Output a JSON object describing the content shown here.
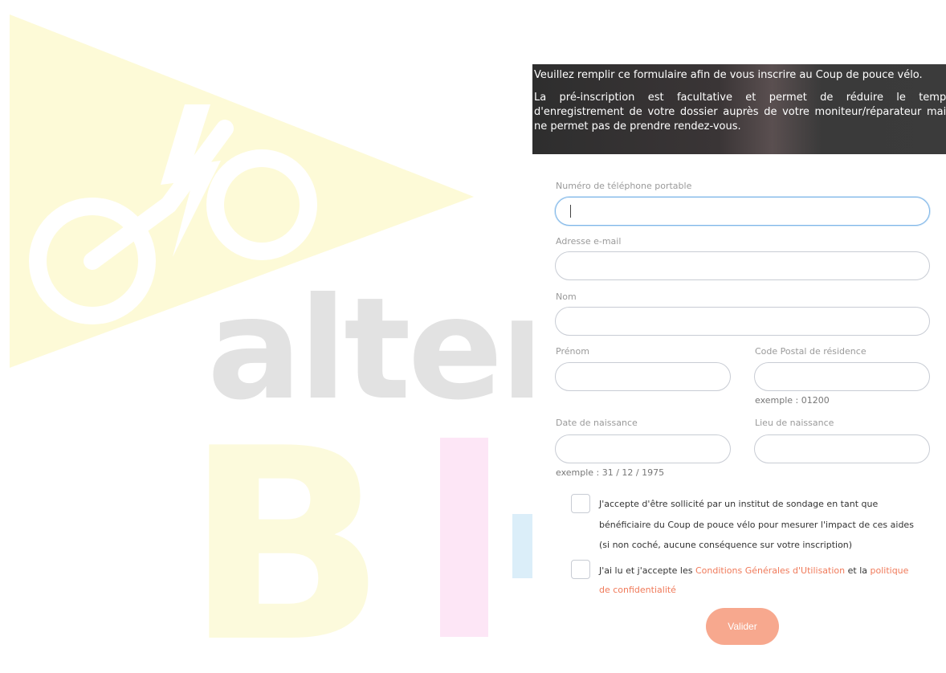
{
  "intro": {
    "line1": "Veuillez remplir ce formulaire afin de vous inscrire au Coup de pouce vélo.",
    "line2": "La pré-inscription est facultative et permet de réduire le temps d'enregistrement de votre dossier auprès de votre moniteur/réparateur mais ne permet pas de prendre rendez-vous."
  },
  "logo": {
    "word": "alter",
    "big_b": "B"
  },
  "form": {
    "phone_label": "Numéro de téléphone portable",
    "phone_value": "",
    "email_label": "Adresse e-mail",
    "email_value": "",
    "nom_label": "Nom",
    "nom_value": "",
    "prenom_label": "Prénom",
    "prenom_value": "",
    "cp_label": "Code Postal de résidence",
    "cp_value": "",
    "cp_hint": "exemple : 01200",
    "dob_label": "Date de naissance",
    "dob_value": "",
    "dob_hint": "exemple : 31 / 12 / 1975",
    "lieu_label": "Lieu de naissance",
    "lieu_value": ""
  },
  "consents": {
    "survey_line1": "J'accepte d'être sollicité par un institut de sondage en tant que",
    "survey_line2": "bénéficiaire du Coup de pouce vélo pour mesurer l'impact de ces aides",
    "survey_line3": "(si non coché, aucune conséquence sur votre inscription)",
    "cgu_prefix": "J'ai lu et j'accepte les ",
    "cgu_link": "Conditions Générales d'Utilisation",
    "cgu_middle": " et la ",
    "privacy_link_part1": "politique",
    "privacy_link_part2": "de confidentialité"
  },
  "submit_label": "Valider",
  "colors": {
    "accent": "#f07a5a",
    "button": "#f7a88e",
    "focus": "#7fb6e8"
  }
}
